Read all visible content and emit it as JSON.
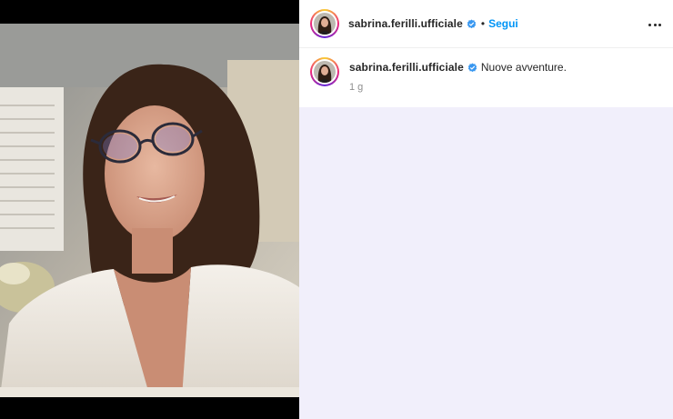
{
  "post": {
    "username": "sabrina.ferilli.ufficiale",
    "follow_label": "Segui",
    "separator": "•",
    "caption": "Nuove avventure.",
    "time_ago": "1 g"
  },
  "icons": {
    "verified": "verified-badge-icon",
    "more": "more-options-icon"
  },
  "colors": {
    "accent": "#0095f6",
    "verified": "#3897f0",
    "comments_background": "#f1effb"
  }
}
